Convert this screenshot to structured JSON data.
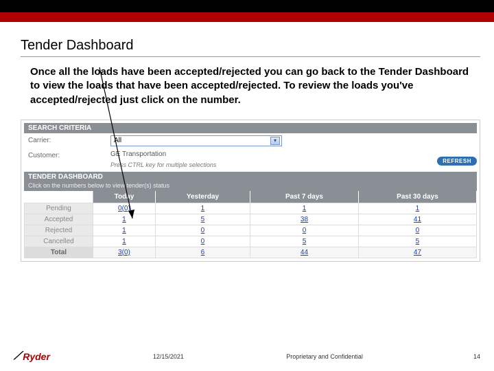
{
  "slide": {
    "title": "Tender Dashboard",
    "instructions": "Once all the loads have been accepted/rejected you can go back to the Tender Dashboard to view the loads that have been accepted/rejected. To review the loads you've accepted/rejected just click on the number."
  },
  "search": {
    "header": "SEARCH CRITERIA",
    "carrier_label": "Carrier:",
    "carrier_value": "All",
    "customer_label": "Customer:",
    "customer_value": "GE Transportation",
    "multi_hint": "Press CTRL key for multiple selections",
    "refresh_label": "REFRESH"
  },
  "dashboard": {
    "header": "TENDER DASHBOARD",
    "sub": "Click on the numbers below to view tender(s) status",
    "columns": [
      "Today",
      "Yesterday",
      "Past 7 days",
      "Past 30 days"
    ],
    "rows": [
      {
        "label": "Pending",
        "cells": [
          "0(0)",
          "1",
          "1",
          "1"
        ]
      },
      {
        "label": "Accepted",
        "cells": [
          "1",
          "5",
          "38",
          "41"
        ]
      },
      {
        "label": "Rejected",
        "cells": [
          "1",
          "0",
          "0",
          "0"
        ]
      },
      {
        "label": "Cancelled",
        "cells": [
          "1",
          "0",
          "5",
          "5"
        ]
      }
    ],
    "total": {
      "label": "Total",
      "cells": [
        "3(0)",
        "6",
        "44",
        "47"
      ]
    }
  },
  "footer": {
    "logo_text": "Ryder",
    "date": "12/15/2021",
    "confidential": "Proprietary and Confidential",
    "page": "14"
  }
}
